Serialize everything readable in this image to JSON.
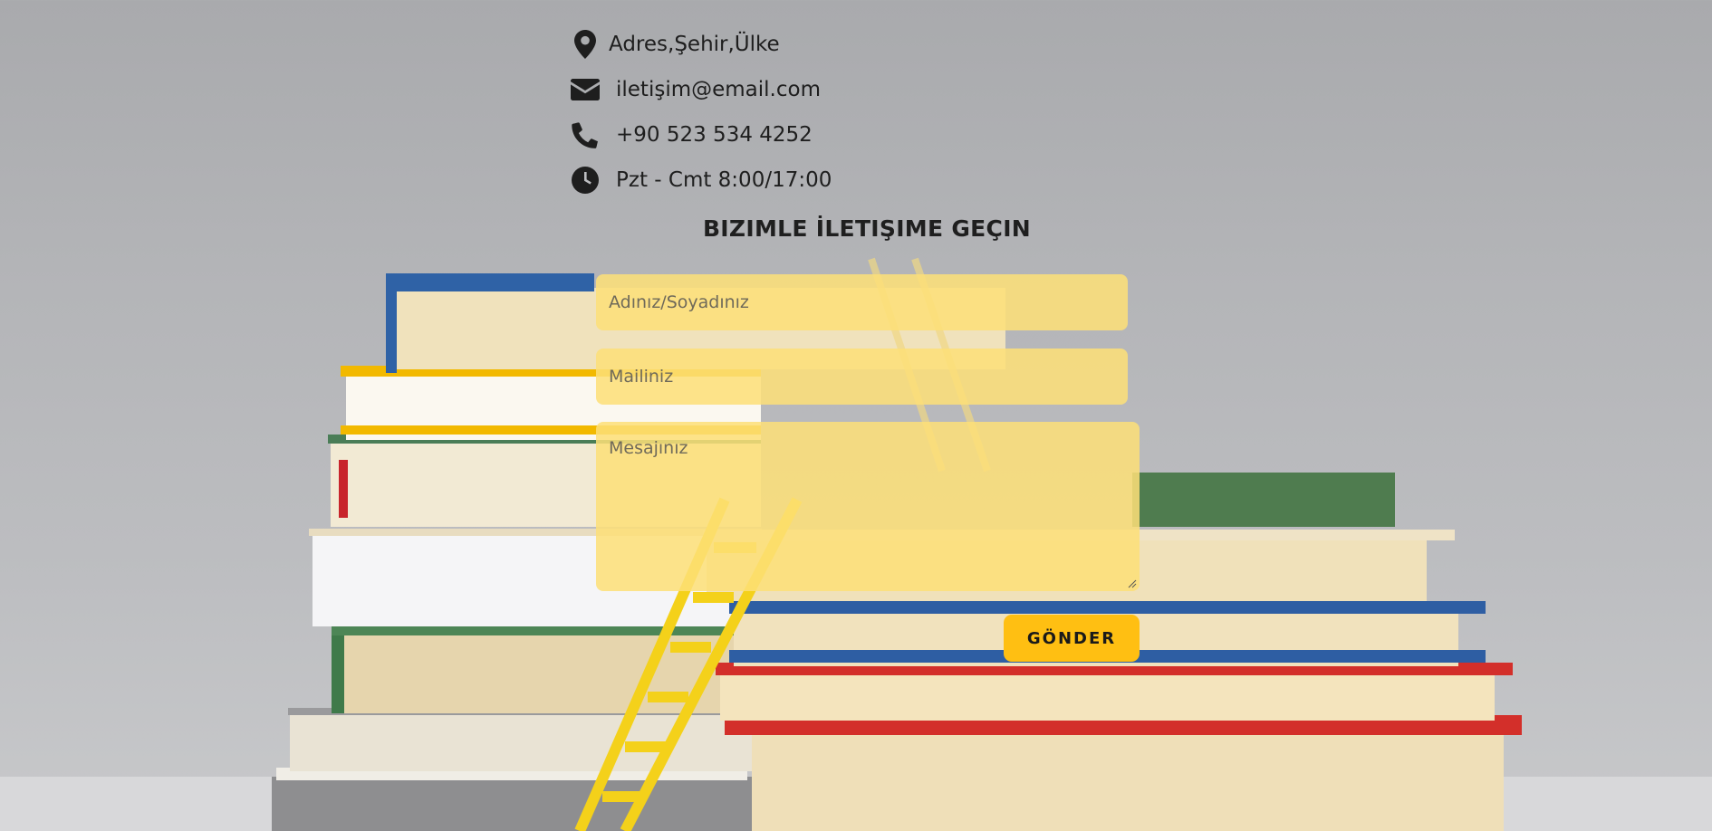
{
  "contact": {
    "address": "Adres,Şehir,Ülke",
    "email": "iletişim@email.com",
    "phone": "+90 523 534 4252",
    "hours": "Pzt - Cmt 8:00/17:00"
  },
  "form": {
    "title": "BIZIMLE İLETIŞIME GEÇIN",
    "name_placeholder": "Adınız/Soyadınız",
    "email_placeholder": "Mailiniz",
    "message_placeholder": "Mesajınız",
    "submit_label": "GÖNDER"
  },
  "icons": {
    "address": "map-marker-icon",
    "email": "envelope-icon",
    "phone": "phone-icon",
    "hours": "clock-icon"
  },
  "colors": {
    "field_bg": "#fde078",
    "button_bg": "#ffbf12",
    "text": "#1e1e1e"
  }
}
